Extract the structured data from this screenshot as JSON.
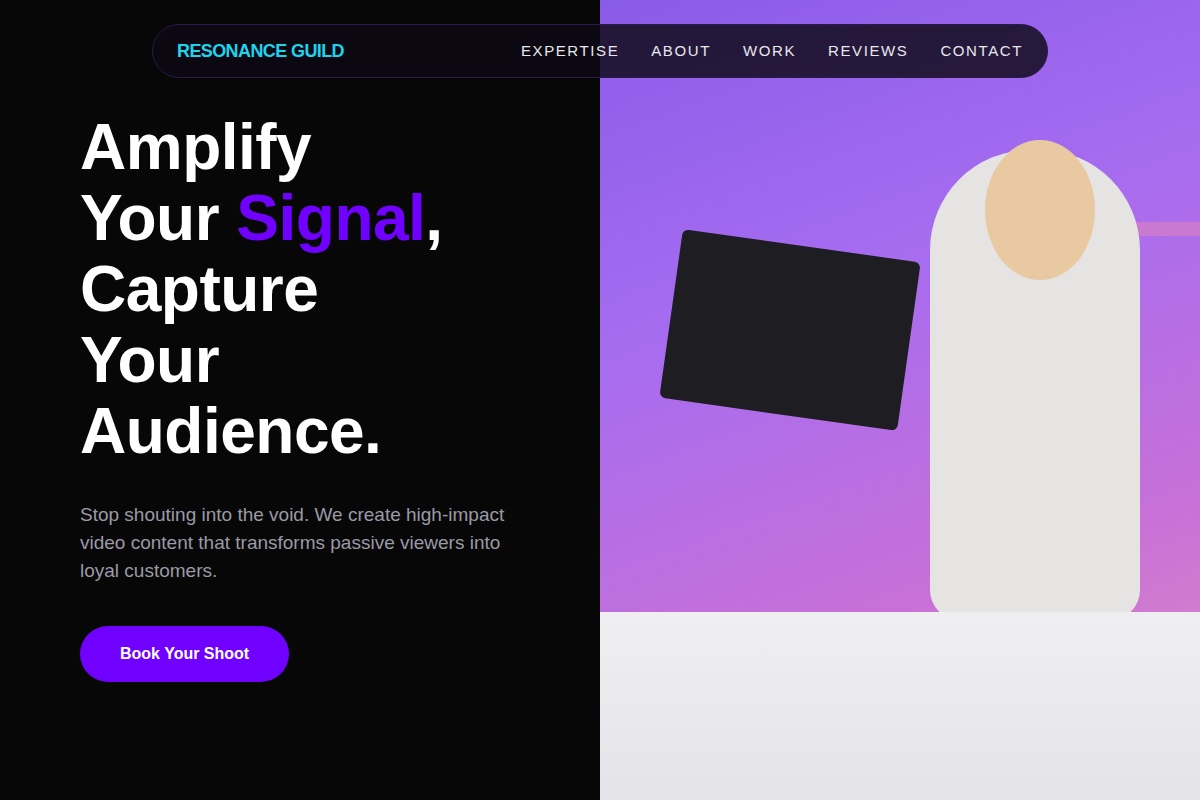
{
  "nav": {
    "logo": "RESONANCE GUILD",
    "links": [
      {
        "label": "EXPERTISE"
      },
      {
        "label": "ABOUT"
      },
      {
        "label": "WORK"
      },
      {
        "label": "REVIEWS"
      },
      {
        "label": "CONTACT"
      }
    ]
  },
  "hero": {
    "headline": [
      [
        {
          "text": "Amplify",
          "accent": false
        }
      ],
      [
        {
          "text": "Your ",
          "accent": false
        },
        {
          "text": "Signal",
          "accent": true
        },
        {
          "text": ",",
          "accent": false
        }
      ],
      [
        {
          "text": "Capture",
          "accent": false
        }
      ],
      [
        {
          "text": "Your",
          "accent": false
        }
      ],
      [
        {
          "text": "Audience.",
          "accent": false
        }
      ]
    ],
    "subtitle": "Stop shouting into the void. We create high-impact video content that transforms passive viewers into loyal customers.",
    "cta": "Book Your Shoot"
  }
}
